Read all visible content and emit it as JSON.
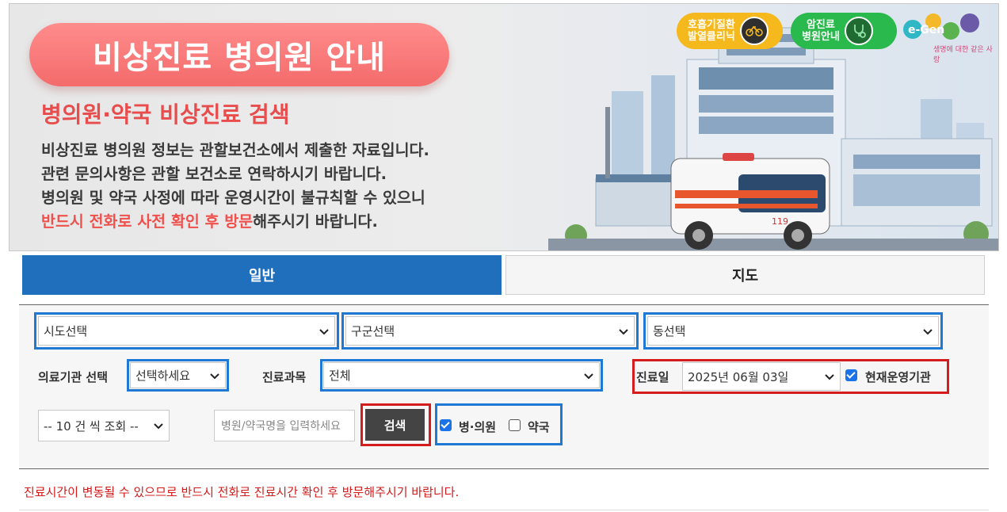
{
  "banner": {
    "title": "비상진료 병의원 안내",
    "subtitle": "병의원·약국 비상진료 검색",
    "desc_line1": "비상진료 병의원 정보는 관할보건소에서 제출한 자료입니다.",
    "desc_line2": "관련 문의사항은 관할 보건소로 연락하시기 바랍니다.",
    "desc_line3": "병의원 및 약국 사정에 따라 운영시간이 불규칙할 수 있으니",
    "desc_line4_highlight": "반드시 전화로 사전 확인 후 방문",
    "desc_line4_rest": "해주시기 바랍니다.",
    "badge_fever_line1": "호흡기질환",
    "badge_fever_line2": "발열클리닉",
    "badge_cancer_line1": "암진료",
    "badge_cancer_line2": "병원안내",
    "logo_text": "e-Gen",
    "logo_tagline": "생명에 대한 같은 사랑",
    "ambulance_label": "119"
  },
  "tabs": [
    {
      "label": "일반",
      "active": true
    },
    {
      "label": "지도",
      "active": false
    }
  ],
  "filters": {
    "sido": "시도선택",
    "gugun": "구군선택",
    "dong": "동선택",
    "institution_label": "의료기관 선택",
    "institution_value": "선택하세요",
    "department_label": "진료과목",
    "department_value": "전체",
    "date_label": "진료일",
    "date_value": "2025년 06월 03일",
    "open_now_label": "현재운영기관",
    "open_now_checked": true,
    "page_size": "-- 10 건 씩 조회 --",
    "search_placeholder": "병원/약국명을 입력하세요",
    "search_button": "검색",
    "hospital_label": "병·의원",
    "hospital_checked": true,
    "pharmacy_label": "약국",
    "pharmacy_checked": false
  },
  "notice": "진료시간이 변동될 수 있으므로 반드시 전화로 진료시간 확인 후 방문해주시기 바랍니다.",
  "colors": {
    "tab_active": "#1f6fbd",
    "banner_pill": "#f46b6b",
    "frame_blue": "#1e78d4",
    "frame_red": "#d41c1c",
    "notice_red": "#d31b1b"
  },
  "icons": [
    "chevron-down-icon",
    "checkbox-icon",
    "bicycle-icon",
    "stethoscope-icon"
  ]
}
